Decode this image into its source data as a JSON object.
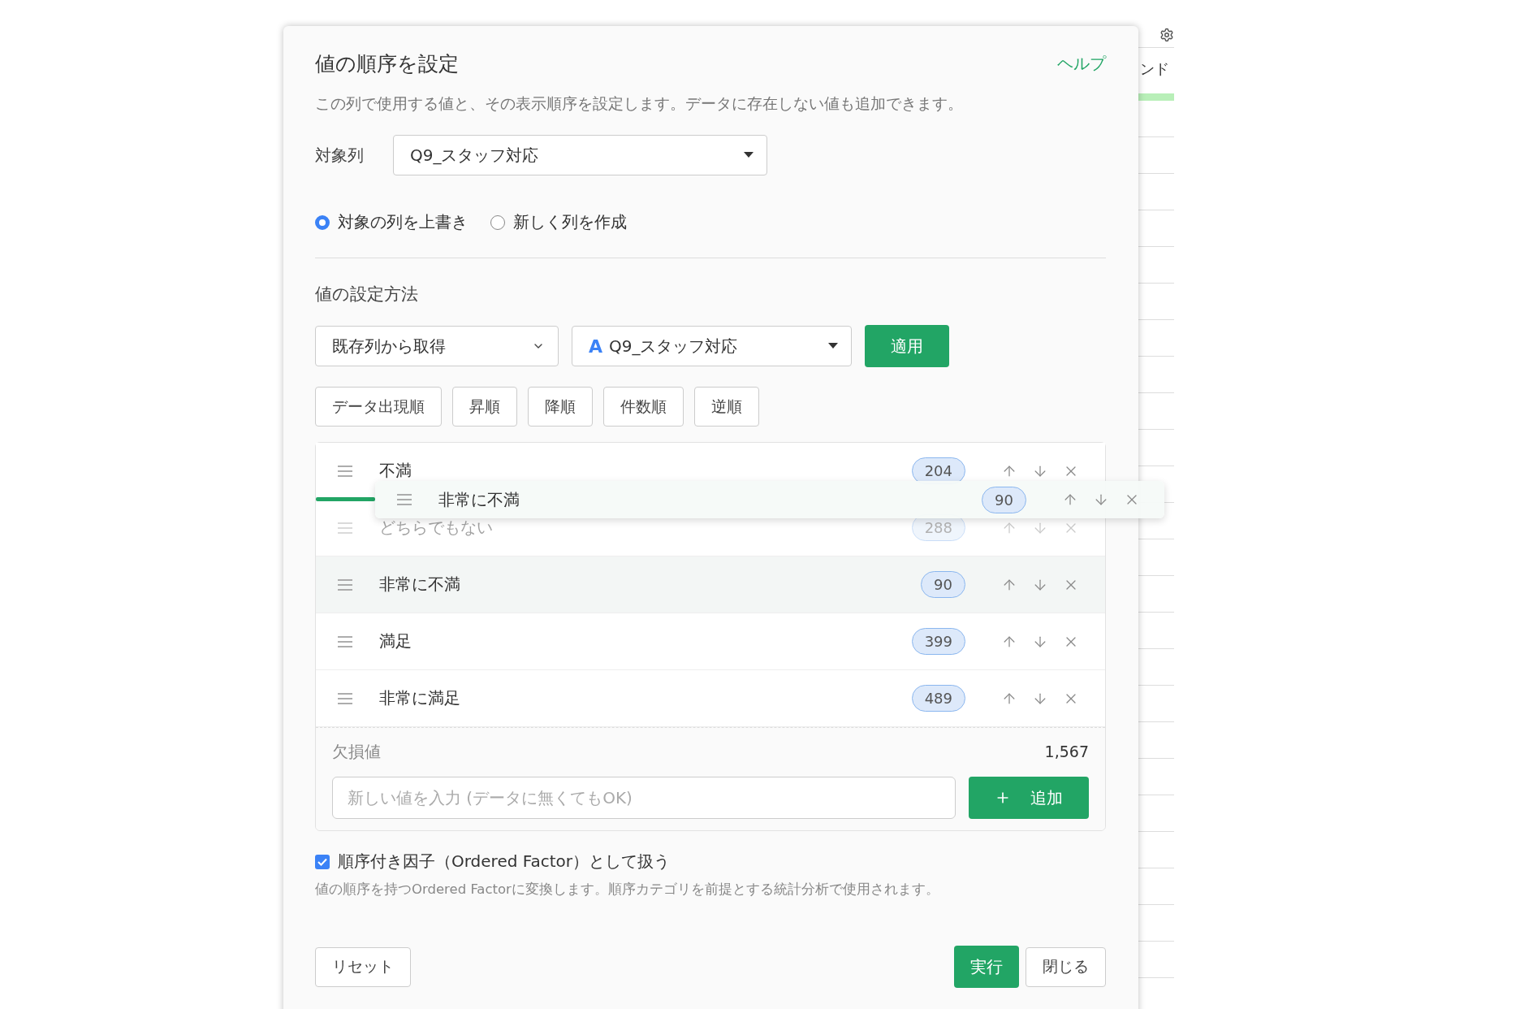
{
  "dialog": {
    "title": "値の順序を設定",
    "help_link": "ヘルプ",
    "description": "この列で使用する値と、その表示順序を設定します。データに存在しない値も追加できます。",
    "target_column": {
      "label": "対象列",
      "value": "Q9_スタッフ対応"
    },
    "output_options": [
      {
        "label": "対象の列を上書き",
        "selected": true
      },
      {
        "label": "新しく列を作成",
        "selected": false
      }
    ],
    "method_section": {
      "title": "値の設定方法",
      "source_select": "既存列から取得",
      "column_select": {
        "type_glyph": "A",
        "value": "Q9_スタッフ対応"
      },
      "apply_button": "適用"
    },
    "sort_buttons": [
      "データ出現順",
      "昇順",
      "降順",
      "件数順",
      "逆順"
    ],
    "values": [
      {
        "label": "不満",
        "count": "204",
        "faded": false,
        "highlighted": false,
        "drop_line_below": true
      },
      {
        "label": "どちらでもない",
        "count": "288",
        "faded": true,
        "highlighted": false,
        "drop_line_below": false
      },
      {
        "label": "非常に不満",
        "count": "90",
        "faded": false,
        "highlighted": true,
        "drop_line_below": false
      },
      {
        "label": "満足",
        "count": "399",
        "faded": false,
        "highlighted": false,
        "drop_line_below": false
      },
      {
        "label": "非常に満足",
        "count": "489",
        "faded": false,
        "highlighted": false,
        "drop_line_below": false
      }
    ],
    "drag_ghost": {
      "label": "非常に不満",
      "count": "90"
    },
    "missing": {
      "label": "欠損値",
      "count": "1,567"
    },
    "new_value": {
      "placeholder": "新しい値を入力 (データに無くてもOK)",
      "add_button": "追加"
    },
    "ordered_factor": {
      "label": "順序付き因子（Ordered Factor）として扱う",
      "checked": true,
      "note": "値の順序を持つOrdered Factorに変換します。順序カテゴリを前提とする統計分析で使用されます。"
    },
    "footer": {
      "reset": "リセット",
      "run": "実行",
      "close": "閉じる"
    }
  },
  "background": {
    "header_text": "ンド"
  }
}
